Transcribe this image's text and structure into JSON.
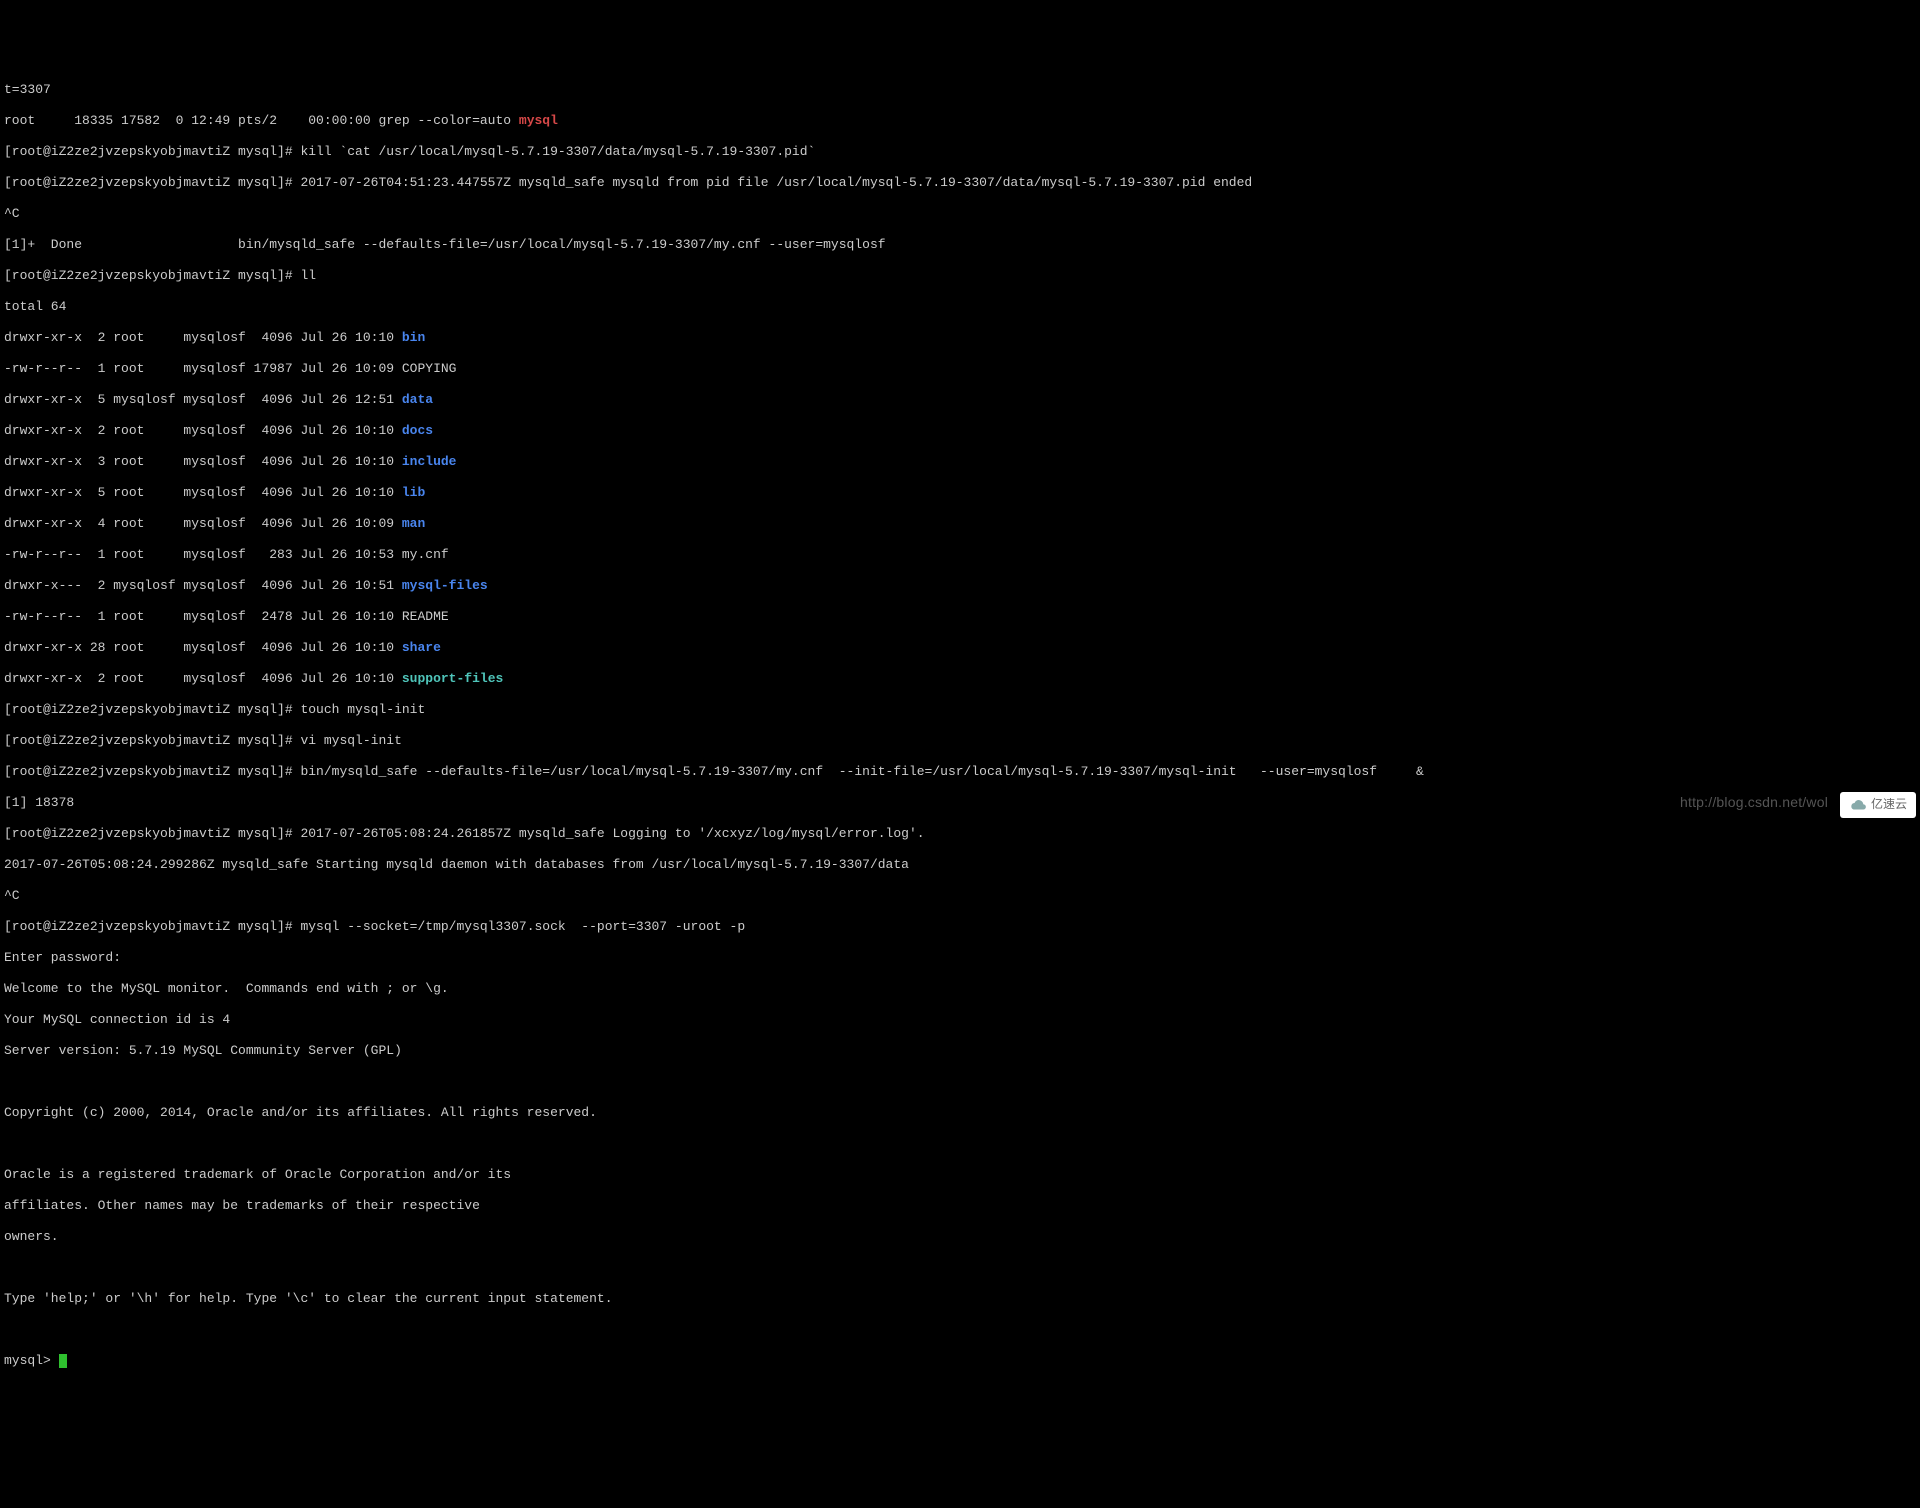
{
  "prompt": "[root@iZ2ze2jvzepskyobjmavtiZ mysql]# ",
  "lines": {
    "l0": "t=3307",
    "ps_root": "root     18335 17582  0 12:49 pts/2    00:00:00 grep --color=auto ",
    "ps_root_hl": "mysql",
    "kill_cmd": "kill `cat /usr/local/mysql-5.7.19-3307/data/mysql-5.7.19-3307.pid`",
    "safe_end": "2017-07-26T04:51:23.447557Z mysqld_safe mysqld from pid file /usr/local/mysql-5.7.19-3307/data/mysql-5.7.19-3307.pid ended",
    "ctrl_c": "^C",
    "done_line": "[1]+  Done                    bin/mysqld_safe --defaults-file=/usr/local/mysql-5.7.19-3307/my.cnf --user=mysqlosf",
    "ll_cmd": "ll",
    "total": "total 64",
    "ls": [
      {
        "pre": "drwxr-xr-x  2 root     mysqlosf  4096 Jul 26 10:10 ",
        "name": "bin",
        "cls": "hl-blue"
      },
      {
        "pre": "-rw-r--r--  1 root     mysqlosf 17987 Jul 26 10:09 COPYING",
        "name": "",
        "cls": ""
      },
      {
        "pre": "drwxr-xr-x  5 mysqlosf mysqlosf  4096 Jul 26 12:51 ",
        "name": "data",
        "cls": "hl-blue"
      },
      {
        "pre": "drwxr-xr-x  2 root     mysqlosf  4096 Jul 26 10:10 ",
        "name": "docs",
        "cls": "hl-blue"
      },
      {
        "pre": "drwxr-xr-x  3 root     mysqlosf  4096 Jul 26 10:10 ",
        "name": "include",
        "cls": "hl-blue"
      },
      {
        "pre": "drwxr-xr-x  5 root     mysqlosf  4096 Jul 26 10:10 ",
        "name": "lib",
        "cls": "hl-blue"
      },
      {
        "pre": "drwxr-xr-x  4 root     mysqlosf  4096 Jul 26 10:09 ",
        "name": "man",
        "cls": "hl-blue"
      },
      {
        "pre": "-rw-r--r--  1 root     mysqlosf   283 Jul 26 10:53 my.cnf",
        "name": "",
        "cls": ""
      },
      {
        "pre": "drwxr-x---  2 mysqlosf mysqlosf  4096 Jul 26 10:51 ",
        "name": "mysql-files",
        "cls": "hl-blue"
      },
      {
        "pre": "-rw-r--r--  1 root     mysqlosf  2478 Jul 26 10:10 README",
        "name": "",
        "cls": ""
      },
      {
        "pre": "drwxr-xr-x 28 root     mysqlosf  4096 Jul 26 10:10 ",
        "name": "share",
        "cls": "hl-blue"
      },
      {
        "pre": "drwxr-xr-x  2 root     mysqlosf  4096 Jul 26 10:10 ",
        "name": "support-files",
        "cls": "hl-teal"
      }
    ],
    "touch_cmd": "touch mysql-init",
    "vi_cmd": "vi mysql-init",
    "start_cmd": "bin/mysqld_safe --defaults-file=/usr/local/mysql-5.7.19-3307/my.cnf  --init-file=/usr/local/mysql-5.7.19-3307/mysql-init   --user=mysqlosf     &",
    "bgjob": "[1] 18378",
    "log1": "2017-07-26T05:08:24.261857Z mysqld_safe Logging to '/xcxyz/log/mysql/error.log'.",
    "log2": "2017-07-26T05:08:24.299286Z mysqld_safe Starting mysqld daemon with databases from /usr/local/mysql-5.7.19-3307/data",
    "ctrl_c2": "^C",
    "mysql_cmd": "mysql --socket=/tmp/mysql3307.sock  --port=3307 -uroot -p",
    "enter_pw": "Enter password:",
    "welcome1": "Welcome to the MySQL monitor.  Commands end with ; or \\g.",
    "welcome2": "Your MySQL connection id is 4",
    "welcome3": "Server version: 5.7.19 MySQL Community Server (GPL)",
    "copyright": "Copyright (c) 2000, 2014, Oracle and/or its affiliates. All rights reserved.",
    "oracle1": "Oracle is a registered trademark of Oracle Corporation and/or its",
    "oracle2": "affiliates. Other names may be trademarks of their respective",
    "oracle3": "owners.",
    "help": "Type 'help;' or '\\h' for help. Type '\\c' to clear the current input statement.",
    "mysql_prompt": "mysql> "
  },
  "watermark_url": "http://blog.csdn.net/wol",
  "watermark_badge": "亿速云"
}
